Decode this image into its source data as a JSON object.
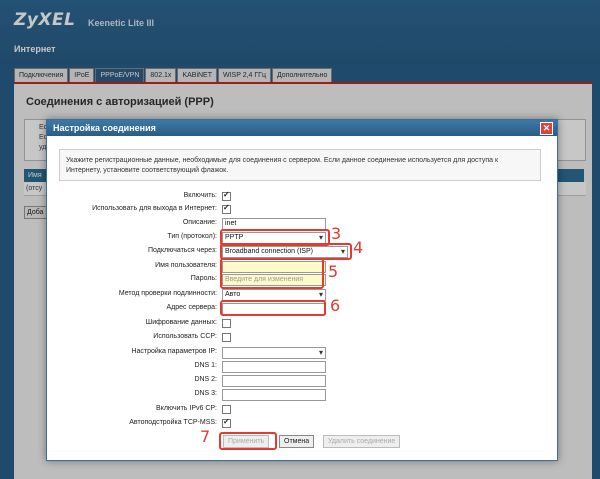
{
  "header": {
    "brand": "ZyXEL",
    "model": "Keenetic Lite III",
    "section": "Интернет"
  },
  "tabs": [
    {
      "label": "Подключения"
    },
    {
      "label": "IPoE"
    },
    {
      "label": "PPPoE/VPN"
    },
    {
      "label": "802.1x"
    },
    {
      "label": "KABiNET"
    },
    {
      "label": "WISP 2,4 ГГц"
    },
    {
      "label": "Дополнительно"
    }
  ],
  "background_page": {
    "title": "Соединения с авторизацией (PPP)",
    "snippets": [
      "Есл",
      "Если",
      "уда"
    ],
    "strip_label": "Имя",
    "row_label": "(отсу",
    "add_button": "Доба"
  },
  "dialog": {
    "title": "Настройка соединения",
    "info": "Укажите регистрационные данные, необходимые для соединения с сервером. Если данное соединение используется для доступа к Интернету, установите соответствующий флажок.",
    "fields": {
      "enable": {
        "label": "Включить:",
        "checked": true
      },
      "use_internet": {
        "label": "Использовать для выхода в Интернет:",
        "checked": true
      },
      "description": {
        "label": "Описание:",
        "value": "inet"
      },
      "protocol": {
        "label": "Тип (протокол):",
        "value": "PPTP"
      },
      "connect_via": {
        "label": "Подключаться через:",
        "value": "Broadband connection (ISP)"
      },
      "username": {
        "label": "Имя пользователя:",
        "value": ""
      },
      "password": {
        "label": "Пароль:",
        "placeholder": "Введите для изменения"
      },
      "auth_method": {
        "label": "Метод проверки подлинности:",
        "value": "Авто"
      },
      "server": {
        "label": "Адрес сервера:",
        "value": ""
      },
      "encryption": {
        "label": "Шифрование данных:",
        "checked": false
      },
      "ccp": {
        "label": "Использовать CCP:",
        "checked": false
      },
      "ip_settings": {
        "label": "Настройка параметров IP:",
        "value": ""
      },
      "dns1": {
        "label": "DNS 1:",
        "value": ""
      },
      "dns2": {
        "label": "DNS 2:",
        "value": ""
      },
      "dns3": {
        "label": "DNS 3:",
        "value": ""
      },
      "ipv6cp": {
        "label": "Включить IPv6 CP:",
        "checked": false
      },
      "tcp_mss": {
        "label": "Автоподстройка TCP-MSS:",
        "checked": true
      }
    },
    "buttons": {
      "apply": "Применить",
      "cancel": "Отмена",
      "delete": "Удалить соединение"
    }
  },
  "annotations": [
    "3",
    "4",
    "5",
    "6",
    "7"
  ],
  "colors": {
    "accent_red": "#e53a2f",
    "header_blue": "#2a5d86",
    "active_tab": "#2d5f86"
  }
}
